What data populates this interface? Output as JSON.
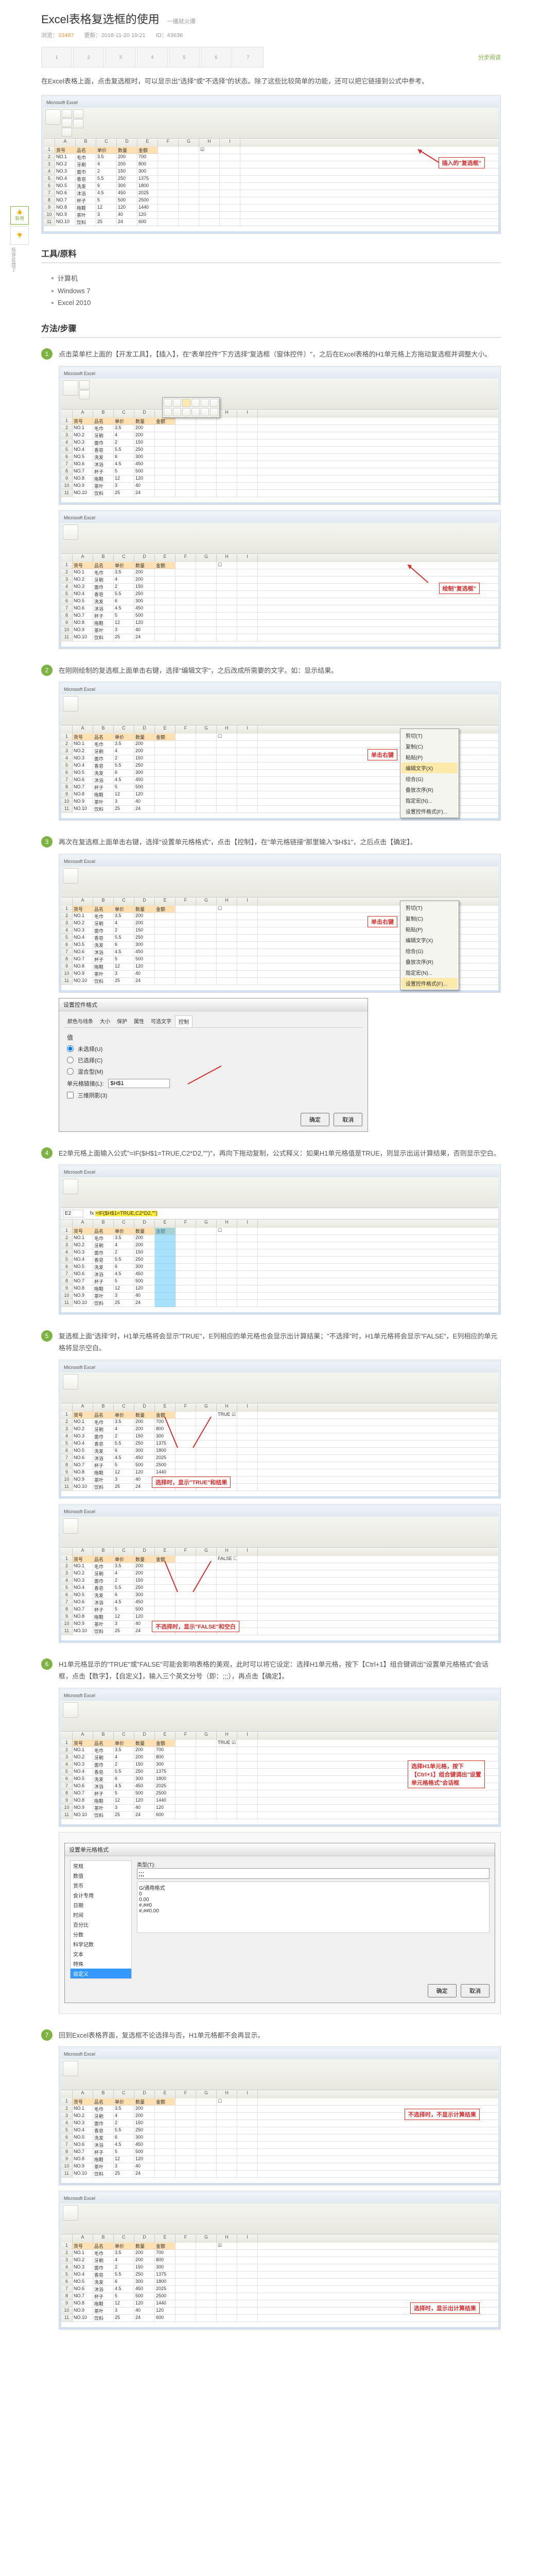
{
  "header": {
    "title": "Excel表格复选框的使用",
    "subtitle": "一播就火爆",
    "views_label": "浏览：",
    "views": "33487",
    "updated_label": "更新：",
    "updated": "2018-11-20 19:21",
    "id_label": "ID：",
    "id": "43636"
  },
  "nav": {
    "items": [
      "1",
      "2",
      "3",
      "4",
      "5",
      "6",
      "7"
    ],
    "step_link": "分步阅读"
  },
  "intro": "在Excel表格上面，点击复选框时，可以显示出\"选择\"或\"不选择\"的状态。除了这些比较简单的功能，还可以把它链接到公式中参考。",
  "annotation1": "插入的\"复选框\"",
  "sections": {
    "tools": "工具/原料",
    "methods": "方法/步骤"
  },
  "tools": {
    "item1": "计算机",
    "item2": "Windows 7",
    "item3": "Excel 2010"
  },
  "vote": {
    "up": "有用",
    "down_text": "投诉/反馈了"
  },
  "steps": [
    {
      "num": "1",
      "text": "点击菜单栏上面的【开发工具】，【插入】，在\"表单控件\"下方选择\"复选框（窗体控件）\"，之后在Excel表格的H1单元格上方拖动复选框并调整大小。",
      "annotation": "绘制\"复选框\""
    },
    {
      "num": "2",
      "text": "在刚刚绘制的复选框上面单击右键，选择\"编辑文字\"，之后改成所需要的文字。如：显示结果。",
      "menu_items": [
        "剪切(T)",
        "复制(C)",
        "粘贴(P)",
        "编辑文字(X)",
        "组合(G)",
        "叠放次序(R)",
        "指定宏(N)...",
        "设置控件格式(F)..."
      ],
      "annotation": "单击右键"
    },
    {
      "num": "3",
      "text": "再次在复选框上面单击右键，选择\"设置单元格格式\"，点击【控制】，在\"单元格链接\"那里输入\"$H$1\"，之后点击【确定】。",
      "dialog_title": "设置控件格式",
      "dialog_tabs": [
        "颜色与线条",
        "大小",
        "保护",
        "属性",
        "可选文字",
        "控制"
      ],
      "dialog_value_label": "值",
      "dialog_unchecked": "未选择(U)",
      "dialog_checked": "已选择(C)",
      "dialog_mixed": "混合型(M)",
      "dialog_link_label": "单元格链接(L):",
      "dialog_link_value": "$H$1",
      "dialog_3d": "三维阴影(3)",
      "dialog_ok": "确定",
      "dialog_cancel": "取消",
      "annotation": "单击右键"
    },
    {
      "num": "4",
      "text": "E2单元格上面输入公式\"=IF($H$1=TRUE,C2*D2,\"\")\"，再向下拖动复制，公式释义：如果H1单元格值是TRUE，则显示出运计算结果，否则显示空白。",
      "formula": "=IF($H$1=TRUE,C2*D2,\"\")"
    },
    {
      "num": "5",
      "text": "复选框上面\"选择\"时，H1单元格将会显示\"TRUE\"，E列相应的单元格也会显示出计算结果；\"不选择\"时，H1单元格将会显示\"FALSE\"，E列相应的单元格将显示空白。",
      "annotation1": "选择时，显示\"TRUE\"和结果",
      "annotation2": "不选择时，显示\"FALSE\"和空白"
    },
    {
      "num": "6",
      "text": "H1单元格显示的\"TRUE\"或\"FALSE\"可能会影响表格的美观，此时可以将它设定：选择H1单元格，按下【Ctrl+1】组合键调出\"设置单元格格式\"会话框，点击【数字】，【自定义】，输入三个英文分号（即：;;;），再点击【确定】。",
      "annotation": "选择H1单元格，按下【Ctrl+1】组合键调出\"设置单元格格式\"会话框",
      "custom_format": ";;;"
    },
    {
      "num": "7",
      "text": "回到Excel表格界面，复选框不论选择与否，H1单元格都不会再显示。",
      "annotation1": "不选择时，不显示计算结果",
      "annotation2": "选择时，显示出计算结果"
    }
  ],
  "excel_cols": [
    "A",
    "B",
    "C",
    "D",
    "E",
    "F",
    "G",
    "H",
    "I"
  ],
  "sample_data": {
    "headers": [
      "货号",
      "品名",
      "单价",
      "数量",
      "金额"
    ],
    "rows": [
      [
        "NO.1",
        "毛巾",
        "3.5",
        "200",
        "700"
      ],
      [
        "NO.2",
        "牙刷",
        "4",
        "200",
        "800"
      ],
      [
        "NO.3",
        "面巾",
        "2",
        "150",
        "300"
      ],
      [
        "NO.4",
        "香皂",
        "5.5",
        "250",
        "1375"
      ],
      [
        "NO.5",
        "洗发",
        "6",
        "300",
        "1800"
      ],
      [
        "NO.6",
        "沐浴",
        "4.5",
        "450",
        "2025"
      ],
      [
        "NO.7",
        "杯子",
        "5",
        "500",
        "2500"
      ],
      [
        "NO.8",
        "拖鞋",
        "12",
        "120",
        "1440"
      ],
      [
        "NO.9",
        "茶叶",
        "3",
        "40",
        "120"
      ],
      [
        "NO.10",
        "饮料",
        "25",
        "24",
        "600"
      ]
    ]
  }
}
